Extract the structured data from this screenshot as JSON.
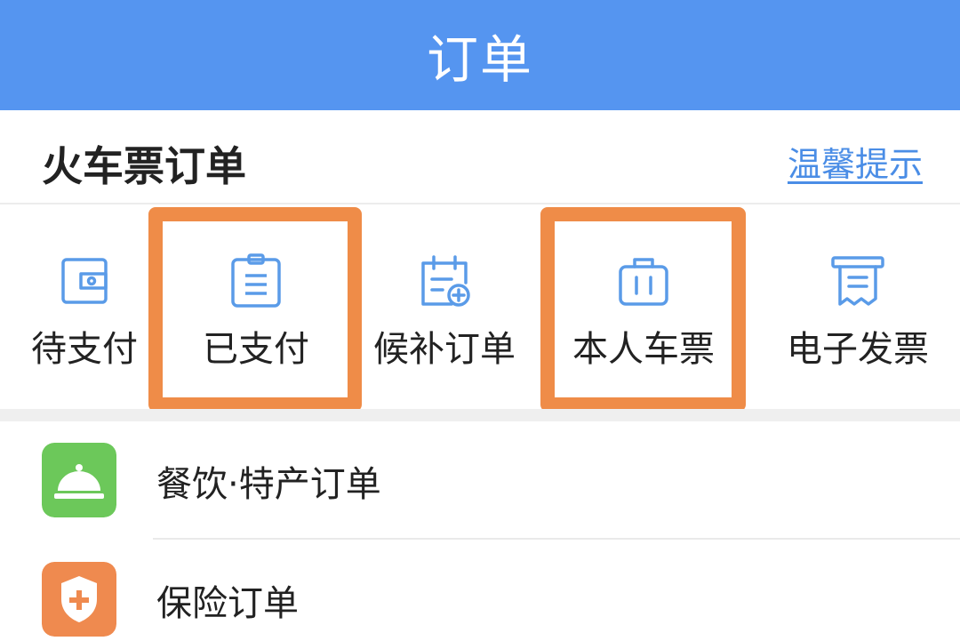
{
  "header": {
    "title": "订单"
  },
  "train_section": {
    "title": "火车票订单",
    "tips_link": "温馨提示"
  },
  "status_items": [
    {
      "label": "待支付",
      "icon": "wallet-icon"
    },
    {
      "label": "已支付",
      "icon": "clipboard-icon"
    },
    {
      "label": "候补订单",
      "icon": "calendar-add-icon"
    },
    {
      "label": "本人车票",
      "icon": "suitcase-icon"
    },
    {
      "label": "电子发票",
      "icon": "receipt-icon"
    }
  ],
  "highlighted_items": [
    "已支付",
    "本人车票"
  ],
  "orders_list": [
    {
      "label": "餐饮·特产订单",
      "icon": "service-bell-icon",
      "icon_color": "#6cc85a"
    },
    {
      "label": "保险订单",
      "icon": "shield-plus-icon",
      "icon_color": "#ef8a4f"
    }
  ],
  "colors": {
    "header": "#5595f0",
    "accent_link": "#4a8de6",
    "highlight": "#ef8c48",
    "icon_stroke": "#5a9be8"
  }
}
